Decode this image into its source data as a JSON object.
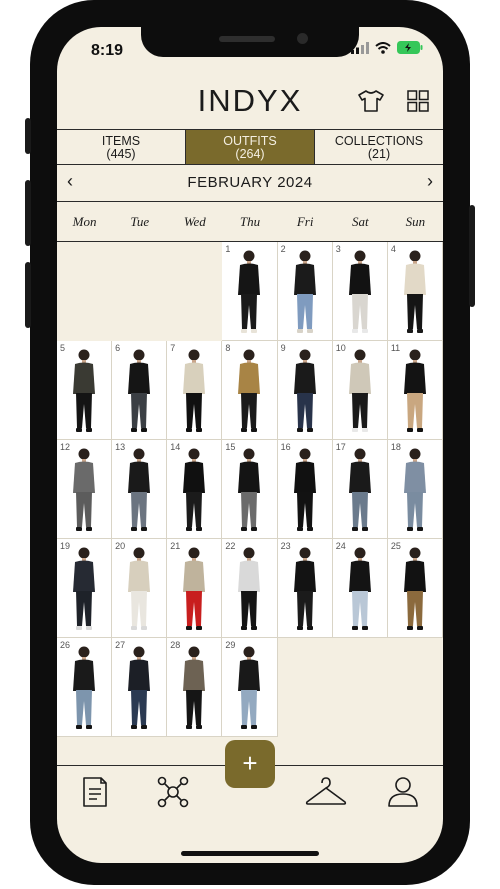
{
  "status_bar": {
    "time": "8:19"
  },
  "app": {
    "logo": "INDYX"
  },
  "tabs": [
    {
      "label": "ITEMS",
      "count": "(445)",
      "active": false
    },
    {
      "label": "OUTFITS",
      "count": "(264)",
      "active": true
    },
    {
      "label": "COLLECTIONS",
      "count": "(21)",
      "active": false
    }
  ],
  "calendar": {
    "month": "FEBRUARY 2024",
    "weekdays": [
      "Mon",
      "Tue",
      "Wed",
      "Thu",
      "Fri",
      "Sat",
      "Sun"
    ],
    "days": [
      "1",
      "2",
      "3",
      "4",
      "5",
      "6",
      "7",
      "8",
      "9",
      "10",
      "11",
      "12",
      "13",
      "14",
      "15",
      "16",
      "17",
      "18",
      "19",
      "20",
      "21",
      "22",
      "23",
      "24",
      "25",
      "26",
      "27",
      "28",
      "29"
    ]
  },
  "bottom_nav": {
    "add_label": "+",
    "items": [
      "notes-icon",
      "network-icon",
      "hanger-icon",
      "profile-icon"
    ]
  },
  "colors": {
    "accent": "#7a6a2c",
    "background": "#f4efe2"
  },
  "outfit_palette": [
    [
      "#151515",
      "#1a1a1a",
      "#e8e3d8"
    ],
    [
      "#1b1b1b",
      "#7f9bbf",
      "#d8d3c8"
    ],
    [
      "#121212",
      "#d9d6d0",
      "#e8e8e8"
    ],
    [
      "#e2d9c7",
      "#151515",
      "#1a1a1a"
    ],
    [
      "#3a3a33",
      "#141414",
      "#141414"
    ],
    [
      "#151515",
      "#3b3f44",
      "#111111"
    ],
    [
      "#d8d0bc",
      "#101010",
      "#0f0f0f"
    ],
    [
      "#a88445",
      "#1a1a1a",
      "#141414"
    ],
    [
      "#1a1a1a",
      "#28334a",
      "#151515"
    ],
    [
      "#cfc8b8",
      "#1a1a1a",
      "#e8e8e8"
    ],
    [
      "#131313",
      "#c9a780",
      "#111111"
    ],
    [
      "#6a6a6a",
      "#5c5c5c",
      "#141414"
    ],
    [
      "#1a1a1a",
      "#6b7480",
      "#141414"
    ],
    [
      "#101010",
      "#1b1b1b",
      "#141414"
    ],
    [
      "#141414",
      "#6b6b6b",
      "#141414"
    ],
    [
      "#111111",
      "#121212",
      "#141414"
    ],
    [
      "#1a1a1a",
      "#6a7a8c",
      "#151515"
    ],
    [
      "#7f8fa3",
      "#7a8ca0",
      "#141414"
    ],
    [
      "#262a33",
      "#1e2229",
      "#d9d9d9"
    ],
    [
      "#d7cfbd",
      "#e9e6df",
      "#d9d9d9"
    ],
    [
      "#bfb39c",
      "#c81e1e",
      "#141414"
    ],
    [
      "#d9d9d9",
      "#151515",
      "#141414"
    ],
    [
      "#131313",
      "#1b1b1b",
      "#141414"
    ],
    [
      "#141414",
      "#b9c7d6",
      "#141414"
    ],
    [
      "#121212",
      "#8b6a3d",
      "#141414"
    ],
    [
      "#1a1a1a",
      "#7d95ad",
      "#141414"
    ],
    [
      "#1c1f26",
      "#2b3a52",
      "#141414"
    ],
    [
      "#6d6253",
      "#151515",
      "#141414"
    ],
    [
      "#191919",
      "#93a9c0",
      "#141414"
    ]
  ]
}
